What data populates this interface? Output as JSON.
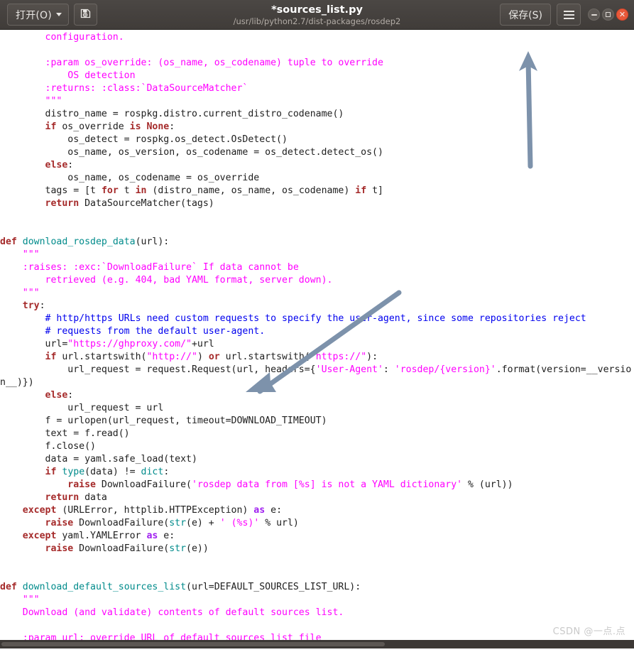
{
  "window": {
    "title": "*sources_list.py",
    "subtitle": "/usr/lib/python2.7/dist-packages/rosdep2",
    "open_button": "打开(O)",
    "save_button": "保存(S)",
    "saveas_icon": "save-as-icon",
    "menu_icon": "hamburger-menu-icon",
    "minimize_icon": "minimize-icon",
    "maximize_icon": "maximize-icon",
    "close_icon": "close-icon",
    "close_glyph": "✕"
  },
  "colors": {
    "titlebar_bg": "#413d3a",
    "editor_bg": "#ffffff",
    "keyword": "#a52a2a",
    "function": "#008b8b",
    "builtin": "#008b8b",
    "string": "#ff00ff",
    "docstring": "#ff00ff",
    "comment": "#0000ee",
    "as_keyword": "#a020f0",
    "plain_text": "#202020",
    "annotation_arrow": "#7d92ab",
    "watermark": "#c9c9c9",
    "close_button": "#e8593a"
  },
  "annotations": [
    {
      "name": "arrow-to-save-button",
      "type": "arrow-up",
      "color": "#7d92ab"
    },
    {
      "name": "arrow-to-url-line",
      "type": "arrow-diagonal-down-left",
      "color": "#7d92ab"
    }
  ],
  "watermark": "CSDN @一点.点",
  "code": {
    "language": "python",
    "lines": [
      {
        "indent": 8,
        "tokens": [
          {
            "t": "doc",
            "v": "configuration."
          }
        ]
      },
      {
        "indent": 0,
        "tokens": []
      },
      {
        "indent": 8,
        "tokens": [
          {
            "t": "doc",
            "v": ":param os_override: (os_name, os_codename) tuple to override"
          }
        ]
      },
      {
        "indent": 12,
        "tokens": [
          {
            "t": "doc",
            "v": "OS detection"
          }
        ]
      },
      {
        "indent": 8,
        "tokens": [
          {
            "t": "doc",
            "v": ":returns: :class:`DataSourceMatcher`"
          }
        ]
      },
      {
        "indent": 8,
        "tokens": [
          {
            "t": "doc",
            "v": "\"\"\""
          }
        ]
      },
      {
        "indent": 8,
        "tokens": [
          {
            "t": "pl",
            "v": "distro_name = rospkg.distro.current_distro_codename()"
          }
        ]
      },
      {
        "indent": 8,
        "tokens": [
          {
            "t": "kw",
            "v": "if"
          },
          {
            "t": "pl",
            "v": " os_override "
          },
          {
            "t": "kw",
            "v": "is"
          },
          {
            "t": "pl",
            "v": " "
          },
          {
            "t": "kw",
            "v": "None"
          },
          {
            "t": "pl",
            "v": ":"
          }
        ]
      },
      {
        "indent": 12,
        "tokens": [
          {
            "t": "pl",
            "v": "os_detect = rospkg.os_detect.OsDetect()"
          }
        ]
      },
      {
        "indent": 12,
        "tokens": [
          {
            "t": "pl",
            "v": "os_name, os_version, os_codename = os_detect.detect_os()"
          }
        ]
      },
      {
        "indent": 8,
        "tokens": [
          {
            "t": "kw",
            "v": "else"
          },
          {
            "t": "pl",
            "v": ":"
          }
        ]
      },
      {
        "indent": 12,
        "tokens": [
          {
            "t": "pl",
            "v": "os_name, os_codename = os_override"
          }
        ]
      },
      {
        "indent": 8,
        "tokens": [
          {
            "t": "pl",
            "v": "tags = [t "
          },
          {
            "t": "kw",
            "v": "for"
          },
          {
            "t": "pl",
            "v": " t "
          },
          {
            "t": "kw",
            "v": "in"
          },
          {
            "t": "pl",
            "v": " (distro_name, os_name, os_codename) "
          },
          {
            "t": "kw",
            "v": "if"
          },
          {
            "t": "pl",
            "v": " t]"
          }
        ]
      },
      {
        "indent": 8,
        "tokens": [
          {
            "t": "kw",
            "v": "return"
          },
          {
            "t": "pl",
            "v": " DataSourceMatcher(tags)"
          }
        ]
      },
      {
        "indent": 0,
        "tokens": []
      },
      {
        "indent": 0,
        "tokens": []
      },
      {
        "indent": 0,
        "tokens": [
          {
            "t": "kw",
            "v": "def"
          },
          {
            "t": "pl",
            "v": " "
          },
          {
            "t": "fn",
            "v": "download_rosdep_data"
          },
          {
            "t": "pl",
            "v": "(url):"
          }
        ]
      },
      {
        "indent": 4,
        "tokens": [
          {
            "t": "doc",
            "v": "\"\"\""
          }
        ]
      },
      {
        "indent": 4,
        "tokens": [
          {
            "t": "doc",
            "v": ":raises: :exc:`DownloadFailure` If data cannot be"
          }
        ]
      },
      {
        "indent": 8,
        "tokens": [
          {
            "t": "doc",
            "v": "retrieved (e.g. 404, bad YAML format, server down)."
          }
        ]
      },
      {
        "indent": 4,
        "tokens": [
          {
            "t": "doc",
            "v": "\"\"\""
          }
        ]
      },
      {
        "indent": 4,
        "tokens": [
          {
            "t": "kw",
            "v": "try"
          },
          {
            "t": "pl",
            "v": ":"
          }
        ]
      },
      {
        "indent": 8,
        "tokens": [
          {
            "t": "cmt",
            "v": "# http/https URLs need custom requests to specify the user-agent, since some repositories reject"
          }
        ]
      },
      {
        "indent": 8,
        "tokens": [
          {
            "t": "cmt",
            "v": "# requests from the default user-agent."
          }
        ]
      },
      {
        "indent": 8,
        "tokens": [
          {
            "t": "pl",
            "v": "url="
          },
          {
            "t": "str",
            "v": "\"https://ghproxy.com/\""
          },
          {
            "t": "pl",
            "v": "+url"
          }
        ]
      },
      {
        "indent": 8,
        "tokens": [
          {
            "t": "kw",
            "v": "if"
          },
          {
            "t": "pl",
            "v": " url.startswith("
          },
          {
            "t": "str",
            "v": "\"http://\""
          },
          {
            "t": "pl",
            "v": ") "
          },
          {
            "t": "kw",
            "v": "or"
          },
          {
            "t": "pl",
            "v": " url.startswith("
          },
          {
            "t": "str",
            "v": "\"https://\""
          },
          {
            "t": "pl",
            "v": "):"
          }
        ]
      },
      {
        "indent": 12,
        "tokens": [
          {
            "t": "pl",
            "v": "url_request = request.Request(url, headers={"
          },
          {
            "t": "str",
            "v": "'User-Agent'"
          },
          {
            "t": "pl",
            "v": ": "
          },
          {
            "t": "str",
            "v": "'rosdep/{version}'"
          },
          {
            "t": "pl",
            "v": ".format(version=__version__)})"
          }
        ]
      },
      {
        "indent": 8,
        "tokens": [
          {
            "t": "kw",
            "v": "else"
          },
          {
            "t": "pl",
            "v": ":"
          }
        ]
      },
      {
        "indent": 12,
        "tokens": [
          {
            "t": "pl",
            "v": "url_request = url"
          }
        ]
      },
      {
        "indent": 8,
        "tokens": [
          {
            "t": "pl",
            "v": "f = urlopen(url_request, timeout=DOWNLOAD_TIMEOUT)"
          }
        ]
      },
      {
        "indent": 8,
        "tokens": [
          {
            "t": "pl",
            "v": "text = f.read()"
          }
        ]
      },
      {
        "indent": 8,
        "tokens": [
          {
            "t": "pl",
            "v": "f.close()"
          }
        ]
      },
      {
        "indent": 8,
        "tokens": [
          {
            "t": "pl",
            "v": "data = yaml.safe_load(text)"
          }
        ]
      },
      {
        "indent": 8,
        "tokens": [
          {
            "t": "kw",
            "v": "if"
          },
          {
            "t": "pl",
            "v": " "
          },
          {
            "t": "bi",
            "v": "type"
          },
          {
            "t": "pl",
            "v": "(data) != "
          },
          {
            "t": "bi",
            "v": "dict"
          },
          {
            "t": "pl",
            "v": ":"
          }
        ]
      },
      {
        "indent": 12,
        "tokens": [
          {
            "t": "kw",
            "v": "raise"
          },
          {
            "t": "pl",
            "v": " DownloadFailure("
          },
          {
            "t": "str",
            "v": "'rosdep data from [%s] is not a YAML dictionary'"
          },
          {
            "t": "pl",
            "v": " % (url))"
          }
        ]
      },
      {
        "indent": 8,
        "tokens": [
          {
            "t": "kw",
            "v": "return"
          },
          {
            "t": "pl",
            "v": " data"
          }
        ]
      },
      {
        "indent": 4,
        "tokens": [
          {
            "t": "kw",
            "v": "except"
          },
          {
            "t": "pl",
            "v": " (URLError, httplib.HTTPException) "
          },
          {
            "t": "as",
            "v": "as"
          },
          {
            "t": "pl",
            "v": " e:"
          }
        ]
      },
      {
        "indent": 8,
        "tokens": [
          {
            "t": "kw",
            "v": "raise"
          },
          {
            "t": "pl",
            "v": " DownloadFailure("
          },
          {
            "t": "bi",
            "v": "str"
          },
          {
            "t": "pl",
            "v": "(e) + "
          },
          {
            "t": "str",
            "v": "' (%s)'"
          },
          {
            "t": "pl",
            "v": " % url)"
          }
        ]
      },
      {
        "indent": 4,
        "tokens": [
          {
            "t": "kw",
            "v": "except"
          },
          {
            "t": "pl",
            "v": " yaml.YAMLError "
          },
          {
            "t": "as",
            "v": "as"
          },
          {
            "t": "pl",
            "v": " e:"
          }
        ]
      },
      {
        "indent": 8,
        "tokens": [
          {
            "t": "kw",
            "v": "raise"
          },
          {
            "t": "pl",
            "v": " DownloadFailure("
          },
          {
            "t": "bi",
            "v": "str"
          },
          {
            "t": "pl",
            "v": "(e))"
          }
        ]
      },
      {
        "indent": 0,
        "tokens": []
      },
      {
        "indent": 0,
        "tokens": []
      },
      {
        "indent": 0,
        "tokens": [
          {
            "t": "kw",
            "v": "def"
          },
          {
            "t": "pl",
            "v": " "
          },
          {
            "t": "fn",
            "v": "download_default_sources_list"
          },
          {
            "t": "pl",
            "v": "(url=DEFAULT_SOURCES_LIST_URL):"
          }
        ]
      },
      {
        "indent": 4,
        "tokens": [
          {
            "t": "doc",
            "v": "\"\"\""
          }
        ]
      },
      {
        "indent": 4,
        "tokens": [
          {
            "t": "doc",
            "v": "Download (and validate) contents of default sources list."
          }
        ]
      },
      {
        "indent": 0,
        "tokens": []
      },
      {
        "indent": 4,
        "tokens": [
          {
            "t": "doc",
            "v": ":param url: override URL of default sources list file"
          }
        ]
      }
    ]
  }
}
